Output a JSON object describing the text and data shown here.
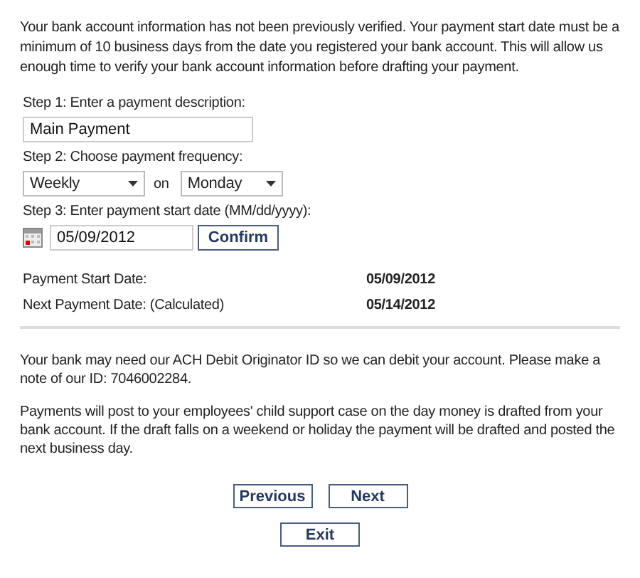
{
  "intro": "Your bank account information has not been previously verified. Your payment start date must be a minimum of 10 business days from the date you registered your bank account. This will allow us enough time to verify your bank account information before drafting your payment.",
  "step1": {
    "label": "Step 1: Enter a payment description:",
    "value": "Main Payment"
  },
  "step2": {
    "label": "Step 2: Choose payment frequency:",
    "frequency": "Weekly",
    "joiner": "on",
    "day": "Monday"
  },
  "step3": {
    "label": "Step 3: Enter payment start date (MM/dd/yyyy):",
    "value": "05/09/2012",
    "button": "Confirm"
  },
  "summary": [
    {
      "label": "Payment Start Date:",
      "value": "05/09/2012"
    },
    {
      "label": "Next Payment Date: (Calculated)",
      "value": "05/14/2012"
    }
  ],
  "notes": [
    "Your bank may need our ACH Debit Originator ID so we can debit your account. Please make a note of our ID: 7046002284.",
    "Payments will post to your employees' child support case on the day money is drafted from your bank account. If the draft falls on a weekend or holiday the payment will be drafted and posted the next business day."
  ],
  "buttons": {
    "row": [
      "Previous",
      "Next"
    ],
    "exit": "Exit"
  }
}
